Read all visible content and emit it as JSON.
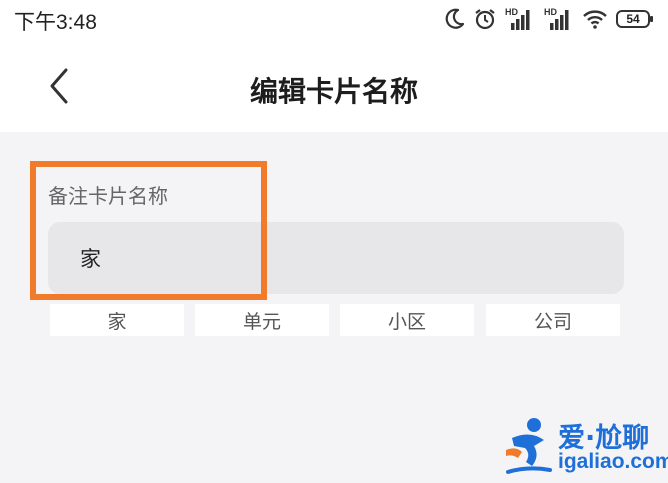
{
  "status_bar": {
    "time": "下午3:48",
    "icons": [
      "moon-icon",
      "alarm-icon",
      "hd-signal-icon",
      "hd-signal-icon",
      "wifi-icon",
      "battery-icon"
    ],
    "battery": "54"
  },
  "header": {
    "title": "编辑卡片名称",
    "back_icon": "chevron-left-icon"
  },
  "form": {
    "label": "备注卡片名称",
    "value": "家"
  },
  "suggestions": [
    "家",
    "单元",
    "小区",
    "公司"
  ],
  "watermark": {
    "title": "爱·尬聊",
    "url": "igaliao.com"
  },
  "colors": {
    "highlight": "#f07b2a",
    "background": "#f4f4f6",
    "input_background": "#e7e7e9",
    "watermark": "#1e6fd8"
  }
}
